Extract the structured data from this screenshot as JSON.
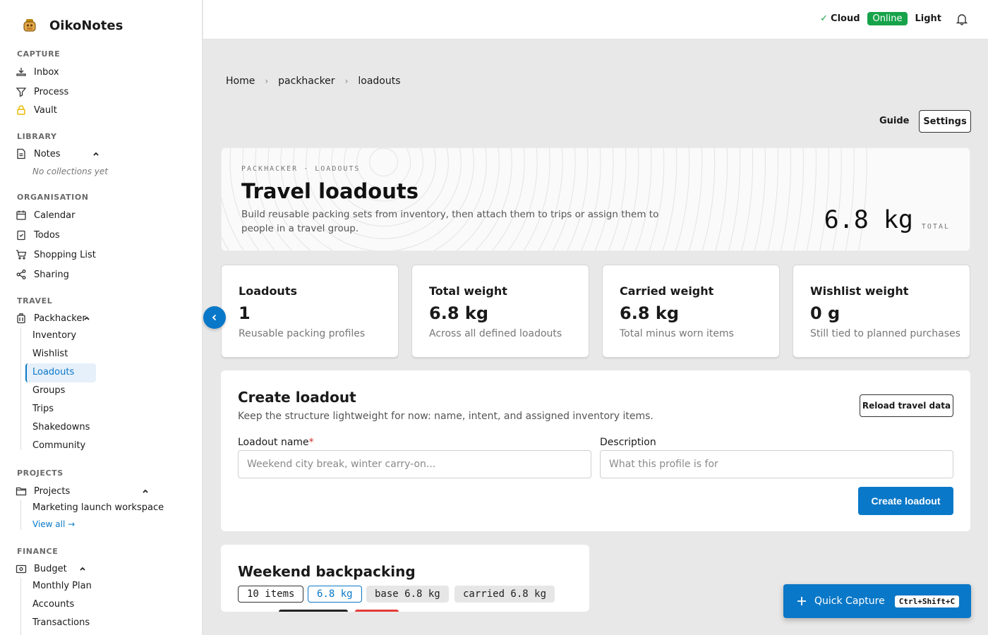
{
  "app": {
    "name": "OikoNotes"
  },
  "sidebar": {
    "sections": {
      "capture": "CAPTURE",
      "library": "LIBRARY",
      "organisation": "ORGANISATION",
      "travel": "TRAVEL",
      "projects": "PROJECTS",
      "finance": "FINANCE"
    },
    "capture_items": [
      "Inbox",
      "Process",
      "Vault"
    ],
    "notes": {
      "label": "Notes",
      "empty": "No collections yet"
    },
    "organisation_items": [
      "Calendar",
      "Todos",
      "Shopping List",
      "Sharing"
    ],
    "packhacker": {
      "label": "Packhacker",
      "children": [
        "Inventory",
        "Wishlist",
        "Loadouts",
        "Groups",
        "Trips",
        "Shakedowns",
        "Community"
      ],
      "active": "Loadouts"
    },
    "projects": {
      "label": "Projects",
      "children": [
        "Marketing launch workspace"
      ],
      "view_all": "View all →"
    },
    "budget": {
      "label": "Budget",
      "children": [
        "Monthly Plan",
        "Accounts",
        "Transactions"
      ]
    }
  },
  "topbar": {
    "cloud": "Cloud",
    "status": "Online",
    "theme": "Light",
    "status_color": "#16a34a"
  },
  "breadcrumb": [
    "Home",
    "packhacker",
    "loadouts"
  ],
  "actions": {
    "guide": "Guide",
    "settings": "Settings"
  },
  "hero": {
    "eyebrow": "PACKHACKER · LOADOUTS",
    "title": "Travel loadouts",
    "description": "Build reusable packing sets from inventory, then attach them to trips or assign them to people in a travel group.",
    "total_value": "6.8 kg",
    "total_label": "TOTAL"
  },
  "stats": [
    {
      "label": "Loadouts",
      "value": "1",
      "sub": "Reusable packing profiles"
    },
    {
      "label": "Total weight",
      "value": "6.8 kg",
      "sub": "Across all defined loadouts"
    },
    {
      "label": "Carried weight",
      "value": "6.8 kg",
      "sub": "Total minus worn items"
    },
    {
      "label": "Wishlist weight",
      "value": "0 g",
      "sub": "Still tied to planned purchases"
    }
  ],
  "create": {
    "title": "Create loadout",
    "description": "Keep the structure lightweight for now: name, intent, and assigned inventory items.",
    "reload": "Reload travel data",
    "name_label": "Loadout name",
    "required_mark": "*",
    "name_placeholder": "Weekend city break, winter carry-on...",
    "desc_label": "Description",
    "desc_placeholder": "What this profile is for",
    "submit": "Create loadout"
  },
  "loadout": {
    "title": "Weekend backpacking",
    "chips": [
      "10 items",
      "6.8 kg",
      "base 6.8 kg",
      "carried 6.8 kg"
    ]
  },
  "quick_capture": {
    "label": "Quick Capture",
    "shortcut": "Ctrl+Shift+C"
  },
  "colors": {
    "accent": "#0a78c8",
    "success": "#16a34a",
    "required": "#d32f2f"
  }
}
